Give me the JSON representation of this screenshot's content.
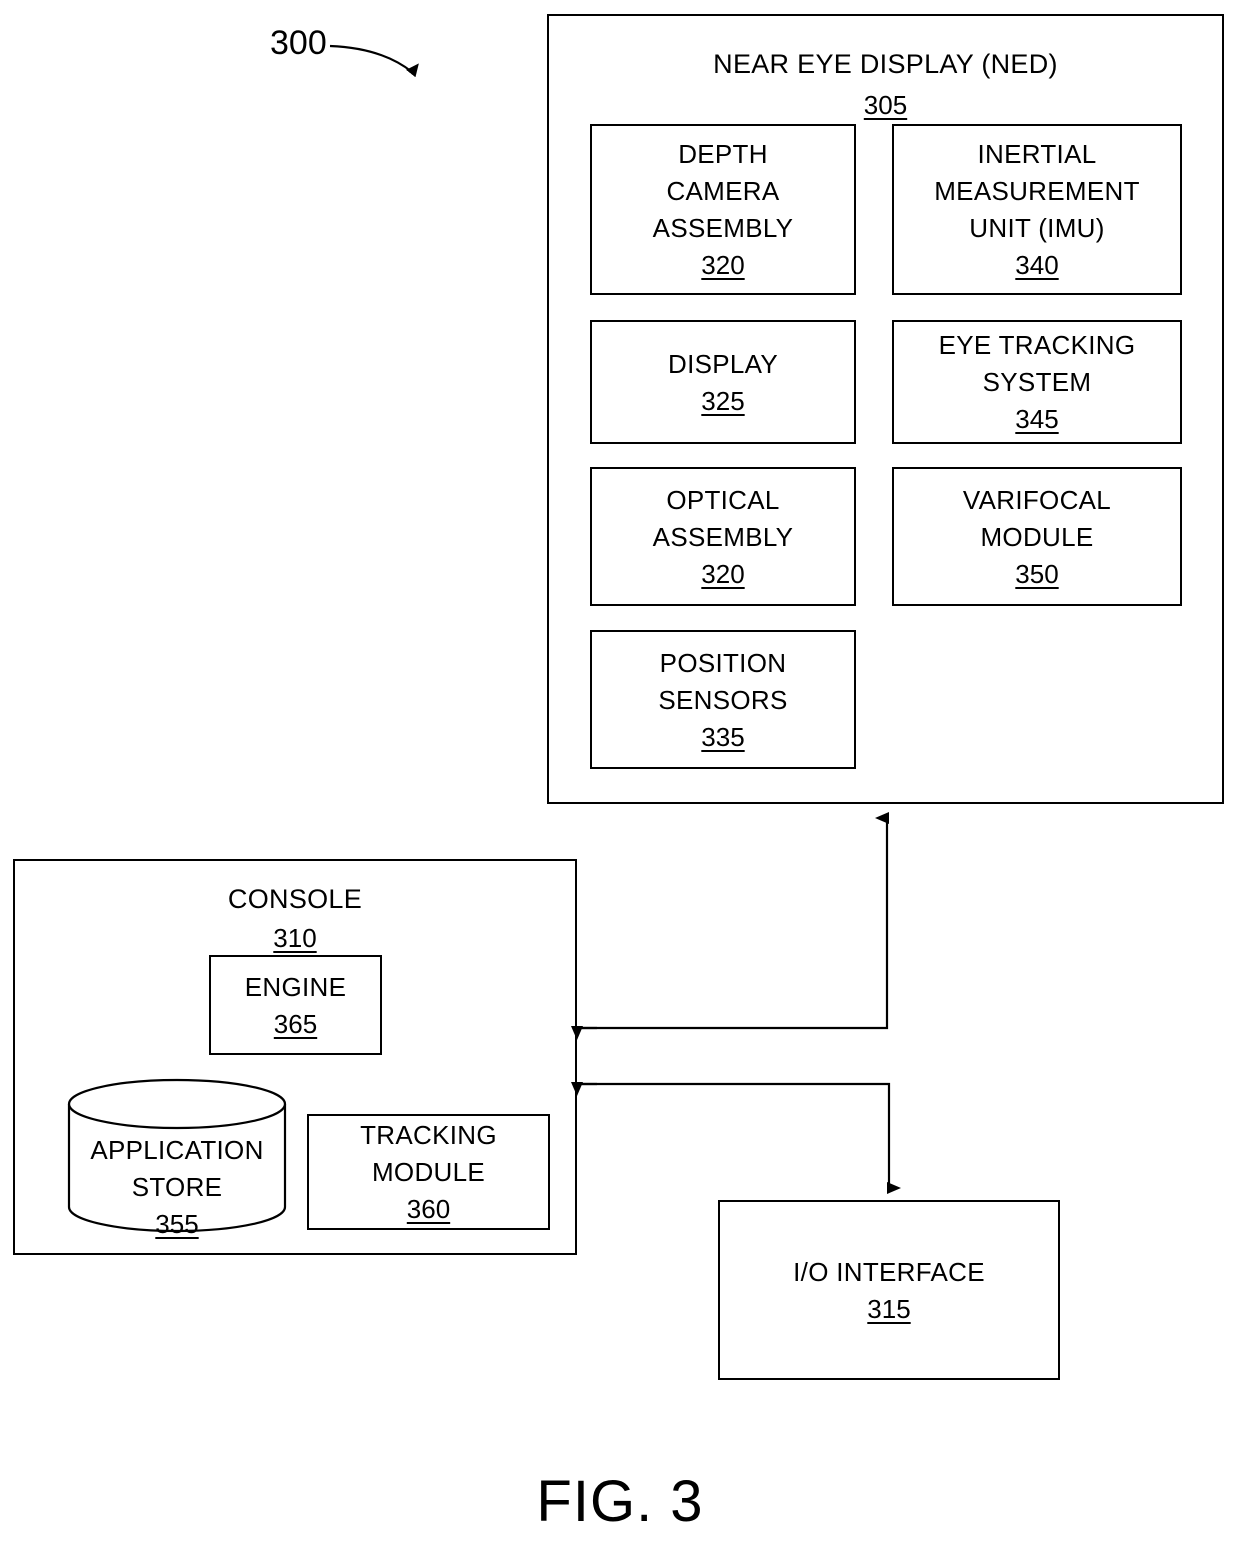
{
  "figure": {
    "caption": "FIG. 3",
    "system_ref": "300"
  },
  "ned": {
    "title": "NEAR EYE DISPLAY (NED)",
    "ref": "305",
    "components": [
      {
        "name": "depth-camera-assembly",
        "lines": [
          "DEPTH",
          "CAMERA",
          "ASSEMBLY"
        ],
        "ref": "320"
      },
      {
        "name": "inertial-measurement-unit",
        "lines": [
          "INERTIAL",
          "MEASUREMENT",
          "UNIT (IMU)"
        ],
        "ref": "340"
      },
      {
        "name": "display",
        "lines": [
          "DISPLAY"
        ],
        "ref": "325"
      },
      {
        "name": "eye-tracking-system",
        "lines": [
          "EYE TRACKING",
          "SYSTEM"
        ],
        "ref": "345"
      },
      {
        "name": "optical-assembly",
        "lines": [
          "OPTICAL",
          "ASSEMBLY"
        ],
        "ref": "320"
      },
      {
        "name": "varifocal-module",
        "lines": [
          "VARIFOCAL",
          "MODULE"
        ],
        "ref": "350"
      },
      {
        "name": "position-sensors",
        "lines": [
          "POSITION",
          "SENSORS"
        ],
        "ref": "335"
      }
    ],
    "l0": "DEPTH",
    "l1": "CAMERA",
    "l2": "ASSEMBLY",
    "r0": "320",
    "l3": "INERTIAL",
    "l4": "MEASUREMENT",
    "l5": "UNIT (IMU)",
    "r1": "340",
    "l6": "DISPLAY",
    "r2": "325",
    "l7": "EYE TRACKING",
    "l8": "SYSTEM",
    "r3": "345",
    "l9": "OPTICAL",
    "l10": "ASSEMBLY",
    "r4": "320",
    "l11": "VARIFOCAL",
    "l12": "MODULE",
    "r5": "350",
    "l13": "POSITION",
    "l14": "SENSORS",
    "r6": "335"
  },
  "console": {
    "title": "CONSOLE",
    "ref": "310",
    "engine": {
      "label": "ENGINE",
      "ref": "365"
    },
    "application_store": {
      "line1": "APPLICATION",
      "line2": "STORE",
      "ref": "355"
    },
    "tracking_module": {
      "line1": "TRACKING",
      "line2": "MODULE",
      "ref": "360"
    }
  },
  "io_interface": {
    "title": "I/O INTERFACE",
    "ref": "315"
  },
  "colors": {
    "stroke": "#000000",
    "background": "#ffffff"
  }
}
